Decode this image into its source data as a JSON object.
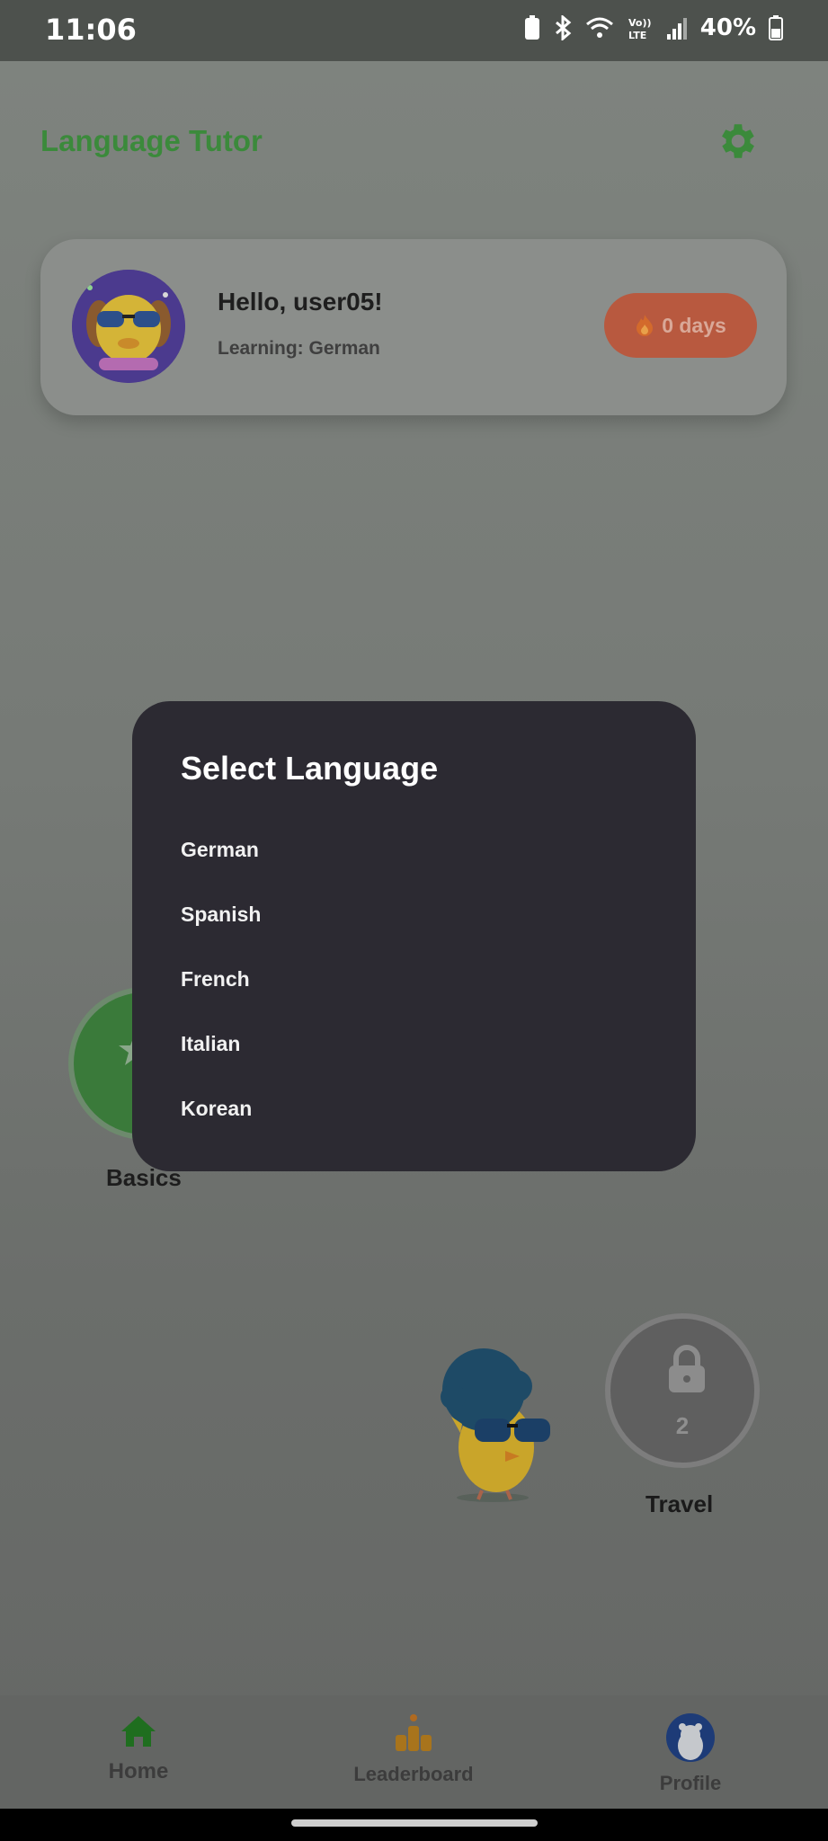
{
  "status_bar": {
    "time": "11:06",
    "battery": "40%"
  },
  "app": {
    "title": "Language Tutor"
  },
  "greeting": {
    "title": "Hello, user05!",
    "subtitle": "Learning: German",
    "streak": "0 days"
  },
  "path": {
    "basics_label": "Basics",
    "travel_label": "Travel",
    "travel_number": "2"
  },
  "dialog": {
    "title": "Select Language",
    "options": [
      "German",
      "Spanish",
      "French",
      "Italian",
      "Korean"
    ]
  },
  "bottom_nav": {
    "home": "Home",
    "leaderboard": "Leaderboard",
    "profile": "Profile"
  },
  "colors": {
    "accent_green": "#3b8a3b",
    "dialog_bg": "#2c2a32",
    "streak_bg": "#b8593f"
  }
}
